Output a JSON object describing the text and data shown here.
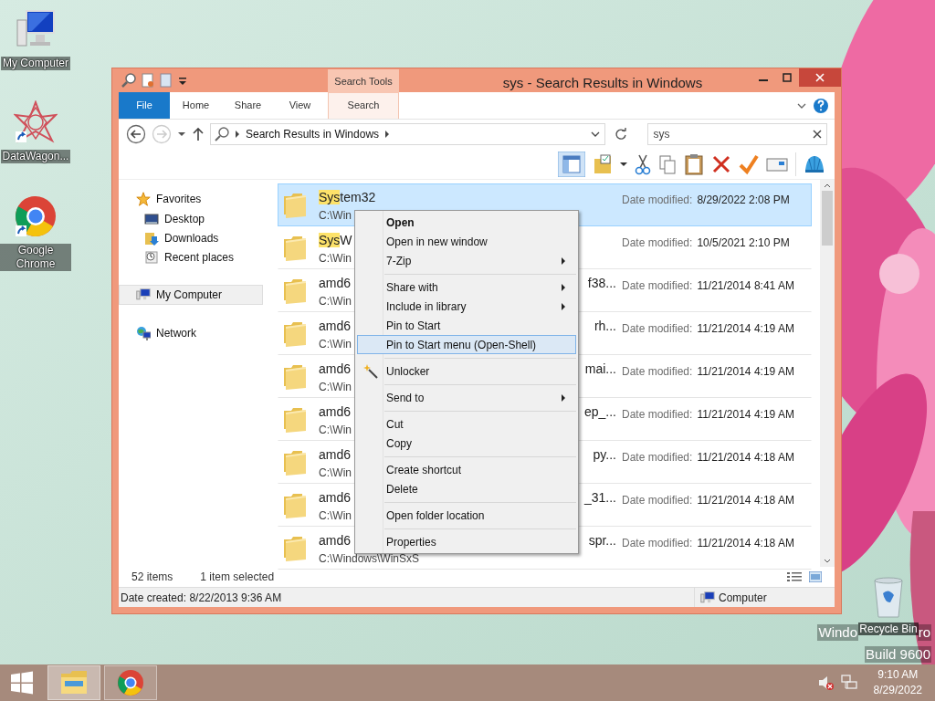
{
  "desktop_icons": [
    {
      "label": "My Computer",
      "kind": "computer",
      "shortcut": false
    },
    {
      "label": "DataWagon...",
      "kind": "star",
      "shortcut": true
    },
    {
      "label": "Google Chrome",
      "kind": "chrome",
      "shortcut": true
    }
  ],
  "recycle_bin": {
    "label": "Recycle Bin"
  },
  "desktop_version_text": {
    "line_1_parts": [
      "Windo",
      "ro"
    ],
    "line_2": "Build 9600"
  },
  "window": {
    "title": "sys - Search Results in Windows",
    "contextual_tab_group": "Search Tools",
    "ribbon_tabs": [
      {
        "label": "File",
        "kind": "file",
        "selected": false
      },
      {
        "label": "Home",
        "kind": "tab",
        "selected": false
      },
      {
        "label": "Share",
        "kind": "tab",
        "selected": false
      },
      {
        "label": "View",
        "kind": "tab",
        "selected": false
      },
      {
        "label": "Search",
        "kind": "contextual",
        "selected": false
      }
    ],
    "address": {
      "path": "Search Results in Windows"
    },
    "search": {
      "value": "sys"
    },
    "nav": [
      {
        "label": "Favorites",
        "kind": "star",
        "selected": false,
        "children": [
          {
            "label": "Desktop",
            "kind": "desktop",
            "selected": false
          },
          {
            "label": "Downloads",
            "kind": "downloads",
            "selected": false
          },
          {
            "label": "Recent places",
            "kind": "recent",
            "selected": false
          }
        ]
      },
      {
        "label": "My Computer",
        "kind": "computer",
        "selected": true
      },
      {
        "label": "Network",
        "kind": "network",
        "selected": false
      }
    ],
    "results": [
      {
        "highlight": "Sys",
        "name": "tem32",
        "path": "C:\\Win",
        "date_label": "Date modified:",
        "date": "8/29/2022 2:08 PM",
        "selected": true
      },
      {
        "highlight": "Sys",
        "name": "W",
        "path": "C:\\Win",
        "date_label": "Date modified:",
        "date": "10/5/2021 2:10 PM",
        "selected": false
      },
      {
        "name": "amd6",
        "tail": "f38...",
        "path": "C:\\Win",
        "date_label": "Date modified:",
        "date": "11/21/2014 8:41 AM",
        "selected": false
      },
      {
        "name": "amd6",
        "tail": "rh...",
        "path": "C:\\Win",
        "date_label": "Date modified:",
        "date": "11/21/2014 4:19 AM",
        "selected": false
      },
      {
        "name": "amd6",
        "tail": "mai...",
        "path": "C:\\Win",
        "date_label": "Date modified:",
        "date": "11/21/2014 4:19 AM",
        "selected": false
      },
      {
        "name": "amd6",
        "tail": "ep_...",
        "path": "C:\\Win",
        "date_label": "Date modified:",
        "date": "11/21/2014 4:19 AM",
        "selected": false
      },
      {
        "name": "amd6",
        "tail": "py...",
        "path": "C:\\Win",
        "date_label": "Date modified:",
        "date": "11/21/2014 4:18 AM",
        "selected": false
      },
      {
        "name": "amd6",
        "tail": "_31...",
        "path": "C:\\Win",
        "date_label": "Date modified:",
        "date": "11/21/2014 4:18 AM",
        "selected": false
      },
      {
        "name": "amd6",
        "tail": "spr...",
        "path": "C:\\Windows\\WinSxS",
        "date_label": "Date modified:",
        "date": "11/21/2014 4:18 AM",
        "selected": false
      }
    ],
    "status": {
      "item_count": "52 items",
      "selection": "1 item selected",
      "date_created": "Date created: 8/22/2013 9:36 AM",
      "location": "Computer"
    }
  },
  "context_menu": [
    {
      "kind": "item",
      "label": "Open",
      "default": true,
      "submenu": false,
      "selected": false
    },
    {
      "kind": "item",
      "label": "Open in new window",
      "default": false,
      "submenu": false,
      "selected": false
    },
    {
      "kind": "item",
      "label": "7-Zip",
      "default": false,
      "submenu": true,
      "selected": false
    },
    {
      "kind": "separator"
    },
    {
      "kind": "item",
      "label": "Share with",
      "default": false,
      "submenu": true,
      "selected": false
    },
    {
      "kind": "item",
      "label": "Include in library",
      "default": false,
      "submenu": true,
      "selected": false
    },
    {
      "kind": "item",
      "label": "Pin to Start",
      "default": false,
      "submenu": false,
      "selected": false
    },
    {
      "kind": "item",
      "label": "Pin to Start menu (Open-Shell)",
      "default": false,
      "submenu": false,
      "selected": true
    },
    {
      "kind": "separator"
    },
    {
      "kind": "icon_item",
      "label": "Unlocker",
      "default": false,
      "submenu": false,
      "selected": false
    },
    {
      "kind": "separator"
    },
    {
      "kind": "item",
      "label": "Send to",
      "default": false,
      "submenu": true,
      "selected": false
    },
    {
      "kind": "separator"
    },
    {
      "kind": "item",
      "label": "Cut",
      "default": false,
      "submenu": false,
      "selected": false
    },
    {
      "kind": "item",
      "label": "Copy",
      "default": false,
      "submenu": false,
      "selected": false
    },
    {
      "kind": "separator"
    },
    {
      "kind": "item",
      "label": "Create shortcut",
      "default": false,
      "submenu": false,
      "selected": false
    },
    {
      "kind": "item",
      "label": "Delete",
      "default": false,
      "submenu": false,
      "selected": false
    },
    {
      "kind": "separator"
    },
    {
      "kind": "item",
      "label": "Open folder location",
      "default": false,
      "submenu": false,
      "selected": false
    },
    {
      "kind": "separator"
    },
    {
      "kind": "item",
      "label": "Properties",
      "default": false,
      "submenu": false,
      "selected": false
    }
  ],
  "taskbar": {
    "apps": [
      {
        "kind": "explorer",
        "active": true
      },
      {
        "kind": "chrome",
        "active": false
      }
    ],
    "volume_muted": true,
    "time": "9:10 AM",
    "date": "8/29/2022"
  }
}
